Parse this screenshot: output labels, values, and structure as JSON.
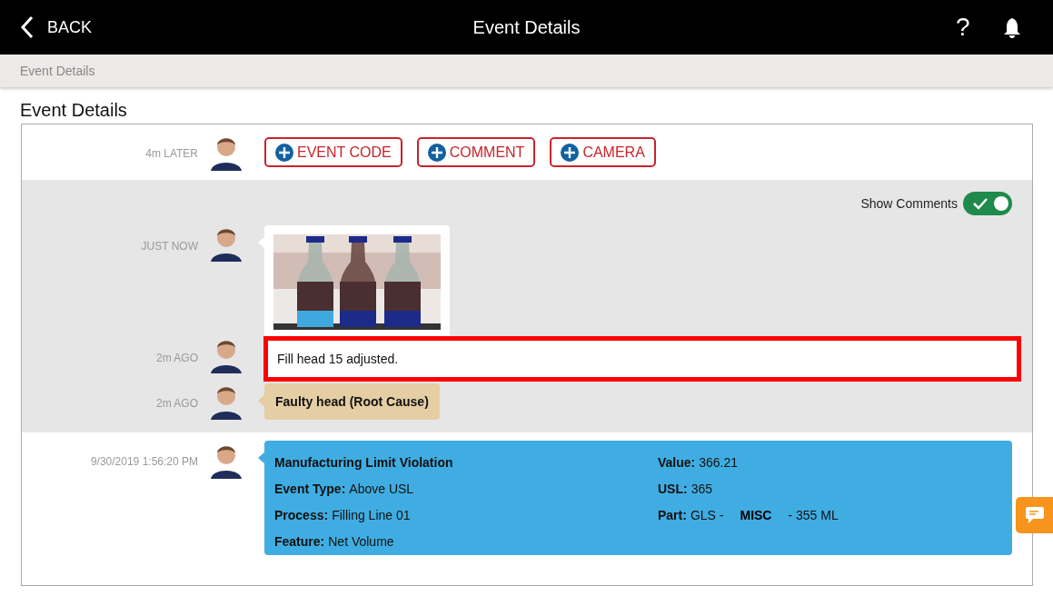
{
  "header": {
    "back_label": "BACK",
    "title": "Event Details",
    "help": "?"
  },
  "breadcrumb": "Event Details",
  "page_title": "Event Details",
  "sections": [
    {
      "shaded": false,
      "entries": [
        {
          "kind": "actions",
          "time": "4m LATER",
          "buttons": [
            "EVENT CODE",
            "COMMENT",
            "CAMERA"
          ]
        }
      ]
    },
    {
      "shaded": true,
      "show_comments": {
        "label": "Show Comments",
        "on": true
      },
      "entries": [
        {
          "time": "JUST NOW"
        },
        {
          "kind": "comment",
          "time": "2m AGO",
          "text": "Fill head 15 adjusted.",
          "highlighted": true
        },
        {
          "kind": "root_cause",
          "time": "2m AGO",
          "text": "Faulty head (Root Cause)"
        }
      ]
    },
    {
      "shaded": false,
      "entries": [
        {
          "kind": "event",
          "time": "9/30/2019 1:56:20 PM",
          "title": "Manufacturing Limit Violation",
          "left_fields": [
            {
              "label": "Event Type:",
              "value": [
                {
                  "text": "Above USL",
                  "bold": false
                }
              ]
            },
            {
              "label": "Process:",
              "value": [
                {
                  "text": "Filling Line 01",
                  "bold": false
                }
              ]
            },
            {
              "label": "Feature:",
              "value": [
                {
                  "text": "Net Volume",
                  "bold": false
                }
              ]
            }
          ],
          "right_fields": [
            {
              "label": "Value:",
              "value": [
                {
                  "text": "366.21",
                  "bold": false
                }
              ]
            },
            {
              "label": "USL:",
              "value": [
                {
                  "text": "365",
                  "bold": false
                }
              ]
            },
            {
              "label": "Part:",
              "value": [
                {
                  "text": "GLS -",
                  "bold": false
                },
                {
                  "text": "MISC",
                  "bold": true
                },
                {
                  "text": "- 355 ML",
                  "bold": false
                }
              ]
            }
          ]
        }
      ]
    }
  ]
}
